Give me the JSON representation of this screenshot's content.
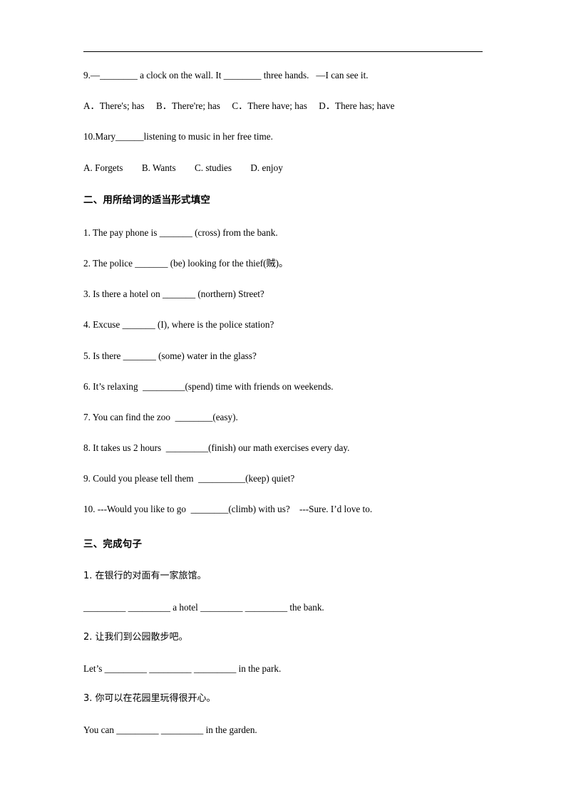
{
  "document": {
    "lines": [
      {
        "id": "q9",
        "text": "9.—________ a clock on the wall. It ________ three hands.   —I can see it."
      },
      {
        "id": "q9_options",
        "text": "A．There's; has     B．There're; has     C．There have; has     D．There has; have"
      },
      {
        "id": "q10",
        "text": "10.Mary______listening to music in her free time."
      },
      {
        "id": "q10_options",
        "text": "A. Forgets        B. Wants        C. studies        D. enjoy"
      },
      {
        "id": "section2_title",
        "text": "二、用所给词的适当形式填空"
      },
      {
        "id": "s2_1",
        "text": "1. The pay phone is _______ (cross) from the bank."
      },
      {
        "id": "s2_2",
        "text": "2. The police _______ (be) looking for the thief(贼)。"
      },
      {
        "id": "s2_3",
        "text": "3. Is there a hotel on _______ (northern) Street?"
      },
      {
        "id": "s2_4",
        "text": "4. Excuse _______ (I), where is the police station?"
      },
      {
        "id": "s2_5",
        "text": "5. Is there _______ (some) water in the glass?"
      },
      {
        "id": "s2_6",
        "text": "6. It’s relaxing  _________(spend) time with friends on weekends."
      },
      {
        "id": "s2_7",
        "text": "7. You can find the zoo  ________(easy)."
      },
      {
        "id": "s2_8",
        "text": "8. It takes us 2 hours  _________(finish) our math exercises every day."
      },
      {
        "id": "s2_9",
        "text": "9. Could you please tell them  __________(keep) quiet?"
      },
      {
        "id": "s2_10",
        "text": "10. ---Would you like to go  ________(climb) with us?    ---Sure. I’d love to."
      },
      {
        "id": "section3_title",
        "text": "三、完成句子"
      },
      {
        "id": "s3_1_cn",
        "text": "1. 在银行的对面有一家旅馆。"
      },
      {
        "id": "s3_1_en",
        "text": "_________ _________ a hotel _________ _________ the bank."
      },
      {
        "id": "s3_2_cn",
        "text": "2. 让我们到公园散步吧。"
      },
      {
        "id": "s3_2_en",
        "text": "Let’s _________ _________ _________ in the park."
      },
      {
        "id": "s3_3_cn",
        "text": "3. 你可以在花园里玩得很开心。"
      },
      {
        "id": "s3_3_en",
        "text": "You can _________ _________ in the garden."
      }
    ]
  }
}
